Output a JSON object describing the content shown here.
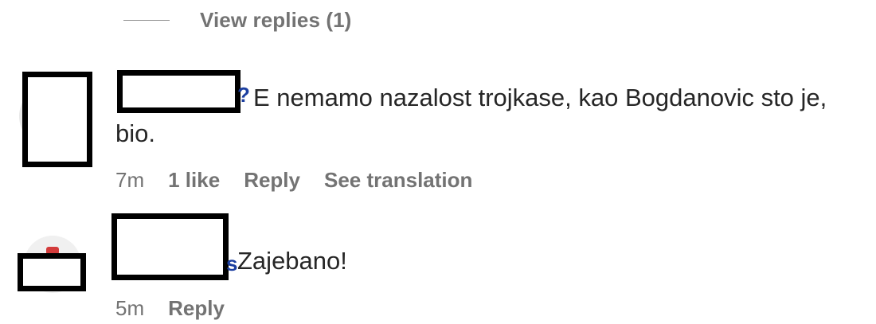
{
  "thread": {
    "view_replies_label": "View replies (1)"
  },
  "comments": [
    {
      "text_line1": "E nemamo nazalost trojkase, kao Bogdanovic sto je,",
      "text_line2": "bio.",
      "time": "7m",
      "likes": "1 like",
      "reply_label": "Reply",
      "translate_label": "See translation"
    },
    {
      "text_line1": "Zajebano!",
      "time": "5m",
      "reply_label": "Reply"
    }
  ]
}
